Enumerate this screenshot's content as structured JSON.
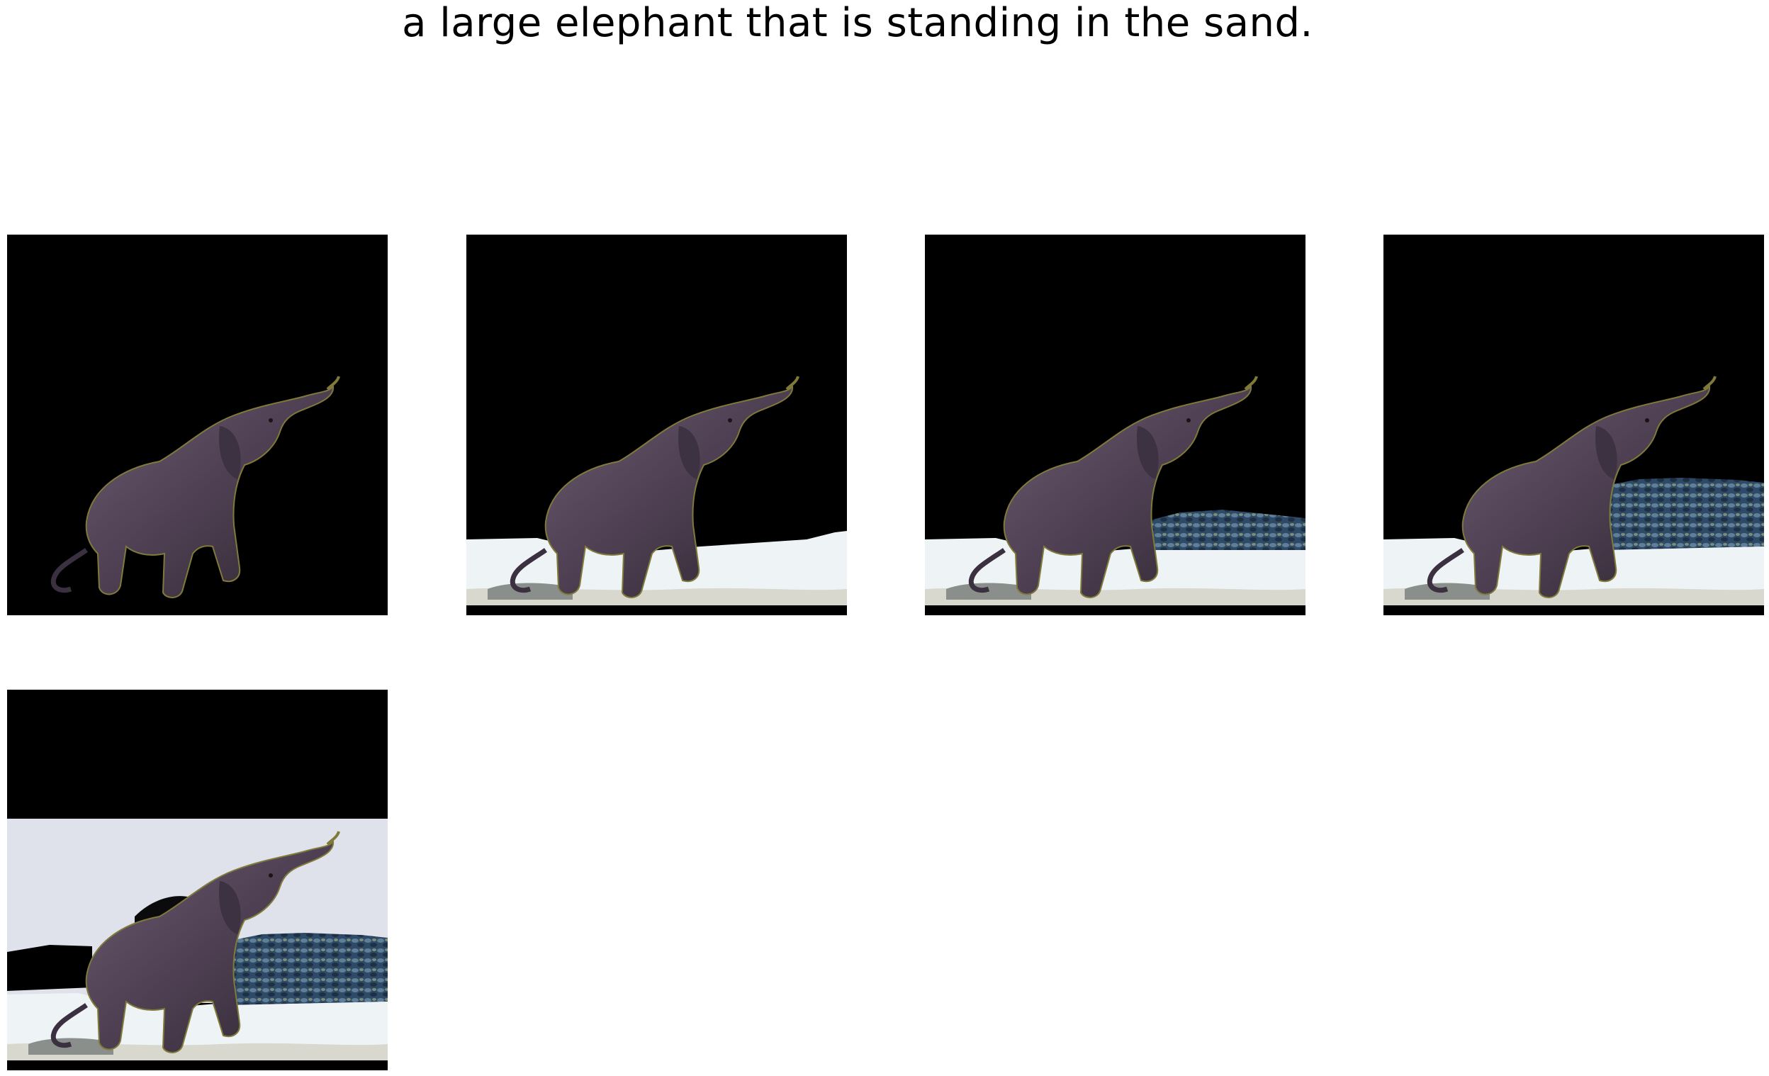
{
  "caption": "a large elephant that is standing in the sand.",
  "frames": [
    {
      "id": 1,
      "layers": [
        "elephant"
      ]
    },
    {
      "id": 2,
      "layers": [
        "elephant",
        "sand"
      ]
    },
    {
      "id": 3,
      "layers": [
        "elephant",
        "sand",
        "rocks-small"
      ]
    },
    {
      "id": 4,
      "layers": [
        "elephant",
        "sand",
        "rocks-large"
      ]
    },
    {
      "id": 5,
      "layers": [
        "sky",
        "elephant",
        "sand",
        "rocks-large"
      ]
    }
  ],
  "colors": {
    "background": "#000000",
    "elephant": "#4e4052",
    "elephant_dark": "#2f2632",
    "elephant_edge": "#7f7a3a",
    "sand": "#eef4f6",
    "sand_shadow": "#c9c6bb",
    "rocks": "#2f4a66",
    "rocks_light": "#5f7f99",
    "sky": "#dfe2ea"
  }
}
